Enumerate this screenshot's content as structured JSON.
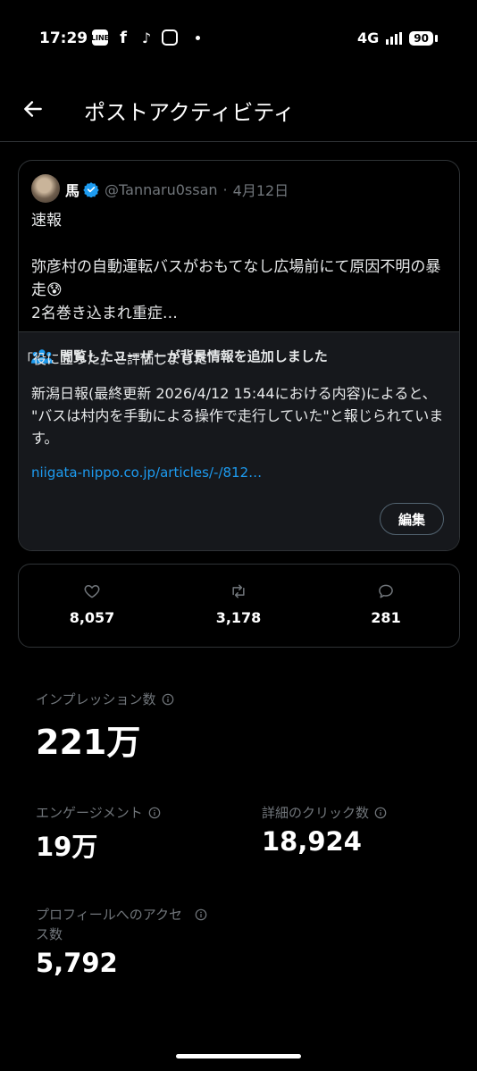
{
  "status_bar": {
    "time": "17:29",
    "apps": [
      "LINE",
      "f",
      "♪"
    ],
    "network": "4G",
    "battery": "90"
  },
  "header": {
    "title": "ポストアクティビティ",
    "back_icon": "arrow-left-icon"
  },
  "post": {
    "author_name": "馬",
    "handle": "@Tannaru0ssan",
    "separator": "·",
    "date": "4月12日",
    "body": "速報\n\n弥彦村の自動運転バスがおもてなし広場前にて原因不明の暴走😰\n2名巻き込まれ重症…"
  },
  "community_note": {
    "title": "閲覧したユーザーが背景情報を追加しました",
    "text": "新潟日報(最終更新 2026/4/12 15:44における内容)によると、\n\"バスは村内を手動による操作で走行していた\"と報じられています。",
    "link": "niigata-nippo.co.jp/articles/-/812…",
    "rated_text": "「役に立った」と評価しました",
    "edit_label": "編集"
  },
  "engagement": {
    "likes": "8,057",
    "reposts": "3,178",
    "replies": "281"
  },
  "metrics": {
    "impressions_label": "インプレッション数",
    "impressions_value": "221万",
    "engagements_label": "エンゲージメント",
    "engagements_value": "19万",
    "detail_clicks_label": "詳細のクリック数",
    "detail_clicks_value": "18,924",
    "profile_visits_label": "プロフィールへのアクセス数",
    "profile_visits_value": "5,792"
  },
  "colors": {
    "background": "#000000",
    "accent": "#1d9bf0",
    "muted": "#71767b",
    "card_border": "#2f3336",
    "note_background": "#16181c"
  }
}
